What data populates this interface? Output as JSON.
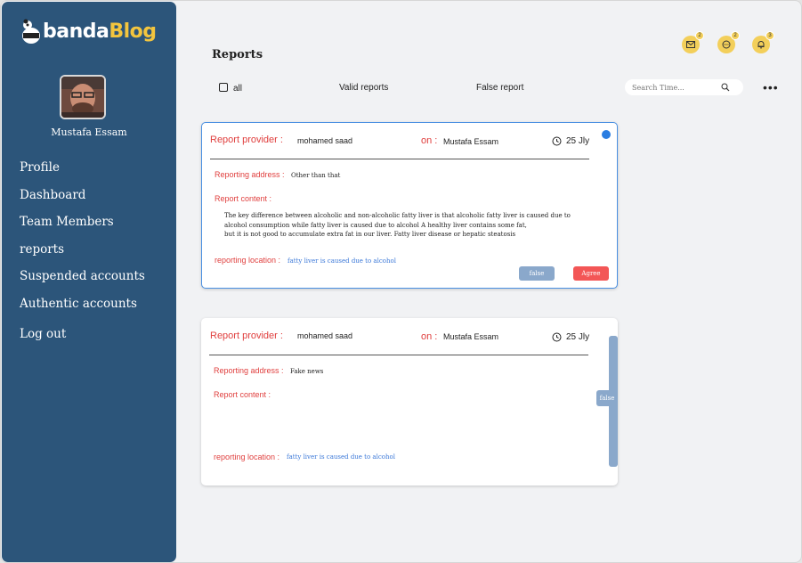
{
  "app": {
    "logo_part1": "banda",
    "logo_part2": "Blog"
  },
  "user": {
    "name": "Mustafa Essam"
  },
  "nav": {
    "items": [
      {
        "label": "Profile"
      },
      {
        "label": "Dashboard"
      },
      {
        "label": "Team Members"
      },
      {
        "label": "reports"
      },
      {
        "label": "Suspended accounts"
      },
      {
        "label": "Authentic accounts"
      },
      {
        "label": "Log out"
      }
    ]
  },
  "header": {
    "title": "Reports",
    "icons": [
      {
        "icon": "mail-icon",
        "badge": "2"
      },
      {
        "icon": "chat-icon",
        "badge": "2"
      },
      {
        "icon": "bell-icon",
        "badge": "3"
      }
    ]
  },
  "filters": {
    "all": "all",
    "valid": "Valid reports",
    "false": "False  report",
    "search_placeholder": "Search Time...",
    "search_value": ""
  },
  "labels": {
    "report_provider": "Report provider :",
    "on": "on :",
    "reporting_address": "Reporting address :",
    "report_content": "Report content :",
    "reporting_location": "reporting location :"
  },
  "reports": [
    {
      "provider": "mohamed saad",
      "on": "Mustafa Essam",
      "date": "25 Jly",
      "address": "Other than that",
      "content_lines": [
        "The key difference between alcoholic and non-alcoholic fatty liver is that alcoholic fatty liver is caused due to",
        "alcohol consumption while fatty liver is caused due to alcohol A healthy liver contains some fat,",
        "but it is not good to accumulate extra fat in our liver. Fatty liver disease or hepatic steatosis"
      ],
      "location": "fatty liver is caused due to alcohol",
      "false_label": "false",
      "agree_label": "Agree"
    },
    {
      "provider": "mohamed saad",
      "on": "Mustafa Essam",
      "date": "25 Jly",
      "address": "Fake news",
      "content_lines": [],
      "location": "fatty liver is caused due to alcohol",
      "false_label": "false"
    }
  ],
  "colors": {
    "sidebar": "#2c557a",
    "accent_red": "#e0403f",
    "accent_blue": "#2a7de1",
    "badge_yellow": "#f3cf5a",
    "button_blue": "#8aa8cb",
    "button_red": "#f35656"
  }
}
